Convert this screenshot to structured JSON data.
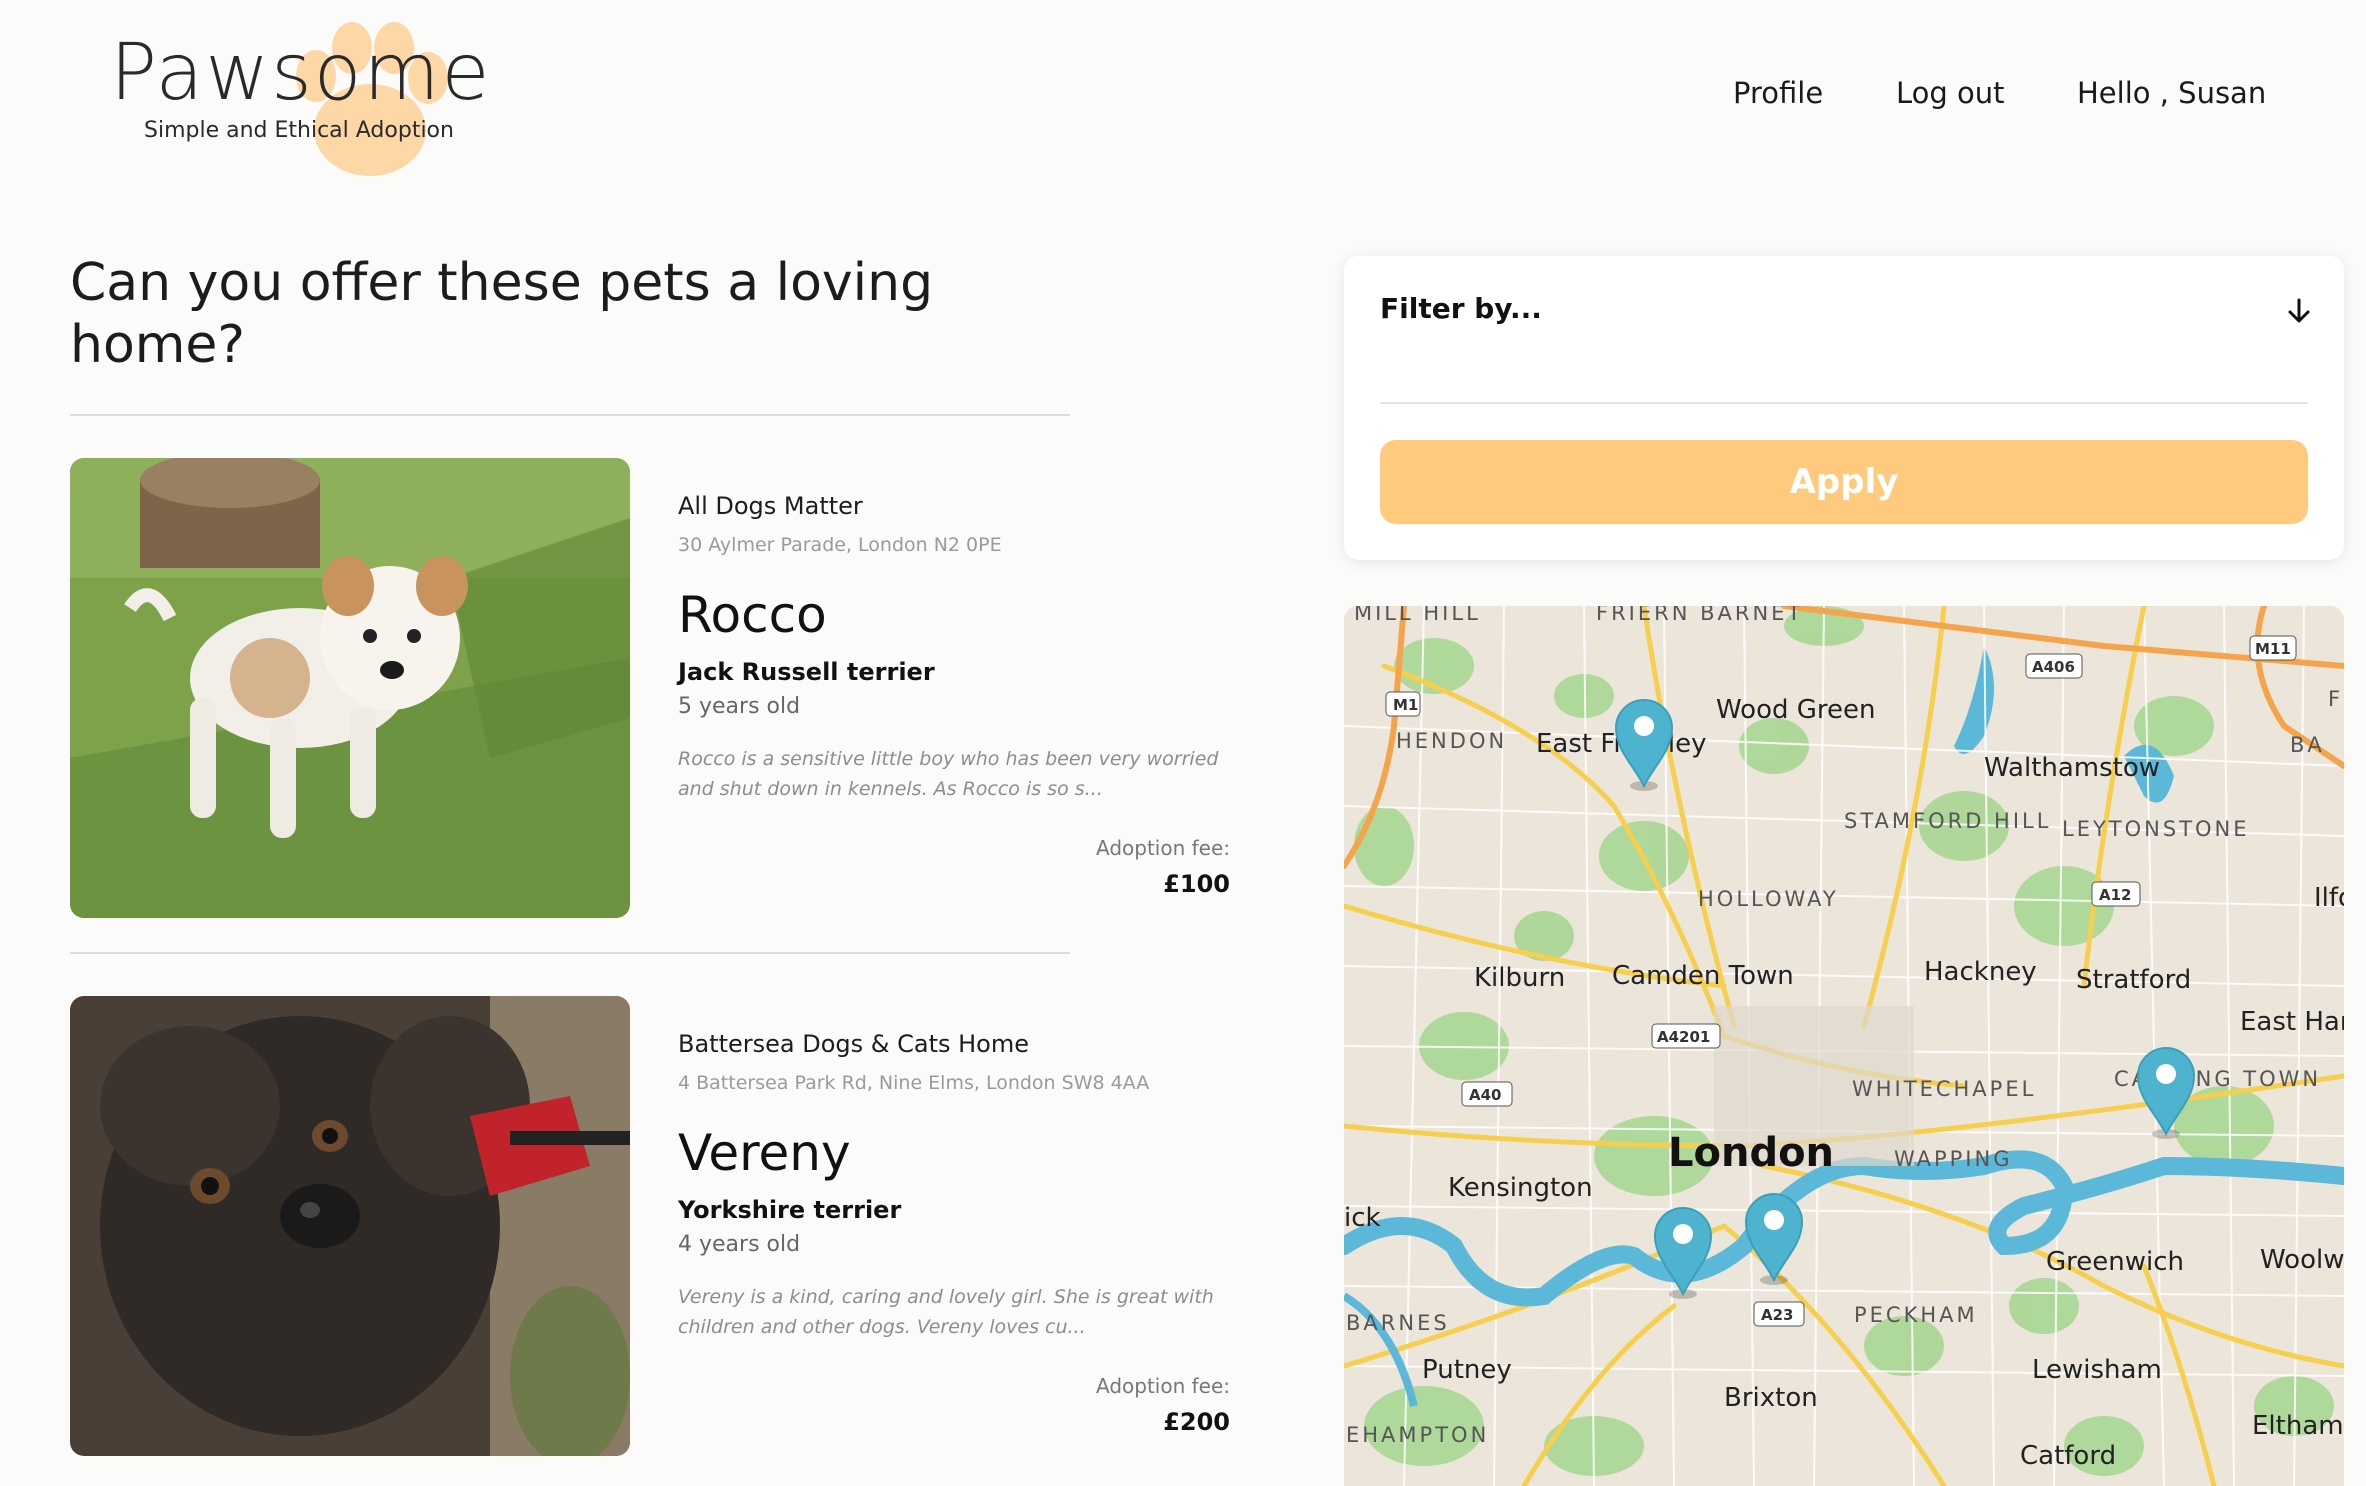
{
  "brand": {
    "name": "Pawsome",
    "tagline": "Simple and Ethical Adoption",
    "paw_color": "#fdd8a6"
  },
  "nav": {
    "profile": "Profile",
    "logout": "Log out",
    "greeting": "Hello , Susan"
  },
  "main": {
    "title": "Can you offer these pets a loving home?"
  },
  "pets": [
    {
      "organisation": "All Dogs Matter",
      "address": "30 Aylmer Parade, London N2 0PE",
      "name": "Rocco",
      "breed": "Jack Russell terrier",
      "age": "5 years old",
      "description": "Rocco is a sensitive little boy who has been very worried and shut down in kennels. As Rocco is so s...",
      "fee_label": "Adoption fee:",
      "fee": "£100"
    },
    {
      "organisation": "Battersea Dogs & Cats Home",
      "address": "4 Battersea Park Rd, Nine Elms, London SW8 4AA",
      "name": "Vereny",
      "breed": "Yorkshire terrier",
      "age": "4 years old",
      "description": "Vereny is a kind, caring and lovely girl. She is great with children and other dogs. Vereny loves cu...",
      "fee_label": "Adoption fee:",
      "fee": "£200"
    }
  ],
  "filter": {
    "label": "Filter by...",
    "apply": "Apply",
    "accent": "#fecb7e"
  },
  "map": {
    "marker_color": "#4db3cf",
    "places": {
      "mill_hill": "MILL HILL",
      "friern_barnet": "FRIERN BARNET",
      "hendon": "HENDON",
      "east_finchley": "East Finchley",
      "wood_green": "Wood Green",
      "walthamstow": "Walthamstow",
      "stamford_hill": "STAMFORD HILL",
      "leytonstone": "LEYTONSTONE",
      "holloway": "HOLLOWAY",
      "ilford": "Ilfo",
      "kilburn": "Kilburn",
      "camden_town": "Camden Town",
      "hackney": "Hackney",
      "stratford": "Stratford",
      "east_ham": "East Har",
      "whitechapel": "WHITECHAPEL",
      "canning_town": "CANNING TOWN",
      "london": "London",
      "wapping": "WAPPING",
      "kensington": "Kensington",
      "chiswick": "ick",
      "greenwich": "Greenwich",
      "woolwich": "Woolw",
      "barnes": "BARNES",
      "peckham": "PECKHAM",
      "putney": "Putney",
      "lewisham": "Lewisham",
      "brixton": "Brixton",
      "roehampton": "EHAMPTON",
      "eltham": "Eltham",
      "catford": "Catford",
      "ba": "BA",
      "f": "F"
    },
    "roads": {
      "m1": "M1",
      "m11": "M11",
      "a406": "A406",
      "a12": "A12",
      "a4201": "A4201",
      "a40": "A40",
      "a23": "A23"
    }
  }
}
